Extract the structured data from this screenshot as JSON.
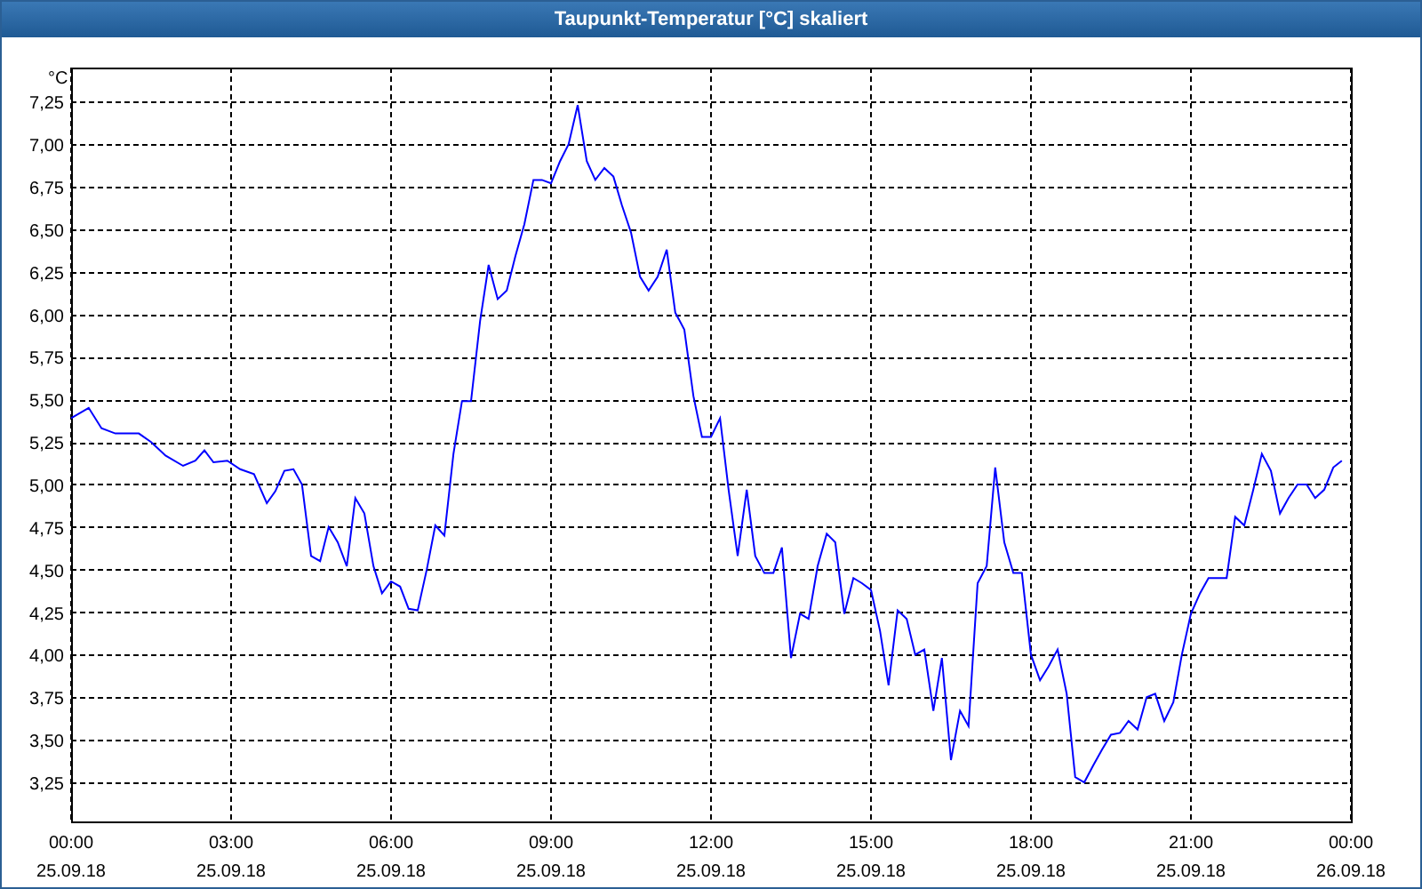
{
  "window": {
    "title": "Taupunkt-Temperatur [°C] skaliert"
  },
  "chart": {
    "xtick_dates": [
      "25.09.18",
      "25.09.18",
      "25.09.18",
      "25.09.18",
      "25.09.18",
      "25.09.18",
      "25.09.18",
      "25.09.18",
      "26.09.18"
    ],
    "chart_data": {
      "type": "line",
      "grid": true,
      "ylabel": "°C",
      "xlim": [
        0,
        24
      ],
      "ylim": [
        3.02,
        7.45
      ],
      "xticks": [
        {
          "value": 0,
          "label": "00:00"
        },
        {
          "value": 3,
          "label": "03:00"
        },
        {
          "value": 6,
          "label": "06:00"
        },
        {
          "value": 9,
          "label": "09:00"
        },
        {
          "value": 12,
          "label": "12:00"
        },
        {
          "value": 15,
          "label": "15:00"
        },
        {
          "value": 18,
          "label": "18:00"
        },
        {
          "value": 21,
          "label": "21:00"
        },
        {
          "value": 24,
          "label": "00:00"
        }
      ],
      "yticks": [
        {
          "value": 3.25,
          "label": "3,25"
        },
        {
          "value": 3.5,
          "label": "3,50"
        },
        {
          "value": 3.75,
          "label": "3,75"
        },
        {
          "value": 4,
          "label": "4,00"
        },
        {
          "value": 4.25,
          "label": "4,25"
        },
        {
          "value": 4.5,
          "label": "4,50"
        },
        {
          "value": 4.75,
          "label": "4,75"
        },
        {
          "value": 5,
          "label": "5,00"
        },
        {
          "value": 5.25,
          "label": "5,25"
        },
        {
          "value": 5.5,
          "label": "5,50"
        },
        {
          "value": 5.75,
          "label": "5,75"
        },
        {
          "value": 6,
          "label": "6,00"
        },
        {
          "value": 6.25,
          "label": "6,25"
        },
        {
          "value": 6.5,
          "label": "6,50"
        },
        {
          "value": 6.75,
          "label": "6,75"
        },
        {
          "value": 7,
          "label": "7,00"
        },
        {
          "value": 7.25,
          "label": "7,25"
        }
      ],
      "x": [
        0,
        0.33,
        0.57,
        0.83,
        1.27,
        1.5,
        1.77,
        2.1,
        2.33,
        2.5,
        2.67,
        2.93,
        3.17,
        3.43,
        3.67,
        3.83,
        4,
        4.17,
        4.33,
        4.5,
        4.67,
        4.83,
        5,
        5.17,
        5.33,
        5.5,
        5.67,
        5.83,
        6,
        6.17,
        6.33,
        6.5,
        6.67,
        6.83,
        7,
        7.17,
        7.33,
        7.5,
        7.67,
        7.83,
        8,
        8.17,
        8.33,
        8.5,
        8.67,
        8.83,
        9,
        9.17,
        9.33,
        9.5,
        9.67,
        9.83,
        10,
        10.17,
        10.33,
        10.5,
        10.67,
        10.83,
        11,
        11.17,
        11.33,
        11.5,
        11.67,
        11.83,
        12,
        12.17,
        12.33,
        12.5,
        12.67,
        12.83,
        13,
        13.17,
        13.33,
        13.5,
        13.67,
        13.83,
        14,
        14.17,
        14.33,
        14.5,
        14.67,
        14.83,
        15,
        15.17,
        15.33,
        15.5,
        15.67,
        15.83,
        16,
        16.17,
        16.33,
        16.5,
        16.67,
        16.83,
        17,
        17.17,
        17.33,
        17.5,
        17.67,
        17.83,
        18,
        18.17,
        18.33,
        18.5,
        18.67,
        18.83,
        19,
        19.17,
        19.33,
        19.5,
        19.67,
        19.83,
        20,
        20.17,
        20.33,
        20.5,
        20.67,
        20.83,
        21,
        21.17,
        21.33,
        21.67,
        21.83,
        22,
        22.17,
        22.33,
        22.5,
        22.67,
        22.83,
        23,
        23.17,
        23.33,
        23.5,
        23.67,
        23.83
      ],
      "series": [
        {
          "color": "#0000ff",
          "values": [
            5.39,
            5.45,
            5.33,
            5.3,
            5.3,
            5.25,
            5.17,
            5.11,
            5.14,
            5.2,
            5.13,
            5.14,
            5.09,
            5.06,
            4.89,
            4.96,
            5.08,
            5.09,
            5,
            4.58,
            4.55,
            4.75,
            4.66,
            4.52,
            4.92,
            4.83,
            4.52,
            4.36,
            4.43,
            4.4,
            4.27,
            4.26,
            4.5,
            4.76,
            4.7,
            5.18,
            5.49,
            5.49,
            5.96,
            6.29,
            6.09,
            6.14,
            6.34,
            6.53,
            6.79,
            6.79,
            6.77,
            6.9,
            7,
            7.23,
            6.9,
            6.79,
            6.86,
            6.81,
            6.64,
            6.48,
            6.22,
            6.14,
            6.22,
            6.38,
            6.01,
            5.91,
            5.52,
            5.28,
            5.28,
            5.39,
            4.97,
            4.58,
            4.97,
            4.58,
            4.48,
            4.48,
            4.63,
            3.98,
            4.24,
            4.21,
            4.52,
            4.71,
            4.66,
            4.24,
            4.45,
            4.42,
            4.38,
            4.14,
            3.82,
            4.26,
            4.21,
            4,
            4.03,
            3.67,
            3.98,
            3.38,
            3.67,
            3.58,
            4.42,
            4.52,
            5.1,
            4.66,
            4.48,
            4.48,
            4,
            3.85,
            3.93,
            4.03,
            3.77,
            3.28,
            3.25,
            3.35,
            3.44,
            3.53,
            3.54,
            3.61,
            3.56,
            3.75,
            3.77,
            3.61,
            3.72,
            4,
            4.24,
            4.36,
            4.45,
            4.45,
            4.81,
            4.76,
            4.97,
            5.18,
            5.08,
            4.83,
            4.92,
            5,
            5,
            4.92,
            4.97,
            5.1,
            5.14
          ]
        }
      ]
    }
  }
}
